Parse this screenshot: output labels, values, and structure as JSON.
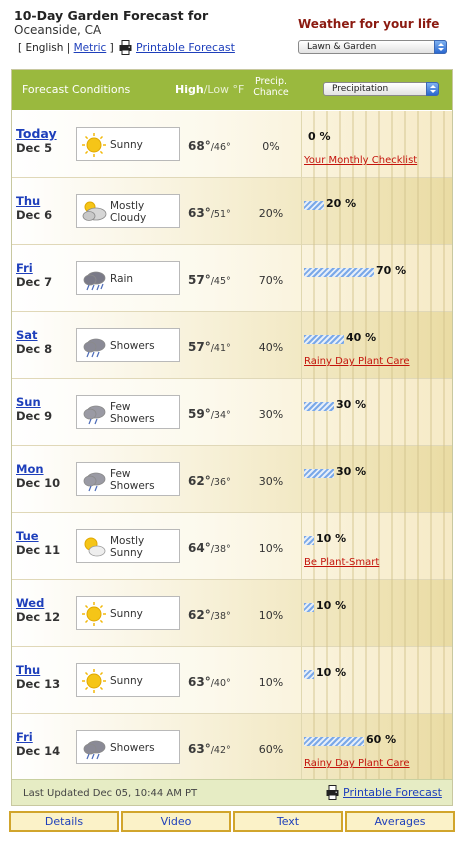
{
  "header": {
    "title": "10-Day Garden Forecast for",
    "location": "Oceanside, CA",
    "lang_open": "[",
    "english": "English",
    "sep": "|",
    "metric": "Metric",
    "lang_close": "]",
    "printable": "Printable Forecast",
    "wfyl": "Weather for your life",
    "lawn_select": "Lawn & Garden"
  },
  "table_header": {
    "conditions": "Forecast Conditions",
    "high": "High",
    "slash_low": "/Low °F",
    "precip_line1": "Precip.",
    "precip_line2": "Chance",
    "precip_select": "Precipitation"
  },
  "rows": [
    {
      "day": "Today",
      "date": "Dec 5",
      "cond": "Sunny",
      "icon": "sunny-icon",
      "hi": "68°",
      "lo": "/46°",
      "pct": "0%",
      "bar_label": "0 %",
      "precip": 0,
      "promo": "Your Monthly Checklist"
    },
    {
      "day": "Thu",
      "date": "Dec 6",
      "cond": "Mostly Cloudy",
      "icon": "mostly-cloudy-icon",
      "hi": "63°",
      "lo": "/51°",
      "pct": "20%",
      "bar_label": "20 %",
      "precip": 20,
      "promo": ""
    },
    {
      "day": "Fri",
      "date": "Dec 7",
      "cond": "Rain",
      "icon": "rain-icon",
      "hi": "57°",
      "lo": "/45°",
      "pct": "70%",
      "bar_label": "70 %",
      "precip": 70,
      "promo": ""
    },
    {
      "day": "Sat",
      "date": "Dec 8",
      "cond": "Showers",
      "icon": "showers-icon",
      "hi": "57°",
      "lo": "/41°",
      "pct": "40%",
      "bar_label": "40 %",
      "precip": 40,
      "promo": "Rainy Day Plant Care"
    },
    {
      "day": "Sun",
      "date": "Dec 9",
      "cond": "Few Showers",
      "icon": "few-showers-icon",
      "hi": "59°",
      "lo": "/34°",
      "pct": "30%",
      "bar_label": "30 %",
      "precip": 30,
      "promo": ""
    },
    {
      "day": "Mon",
      "date": "Dec 10",
      "cond": "Few Showers",
      "icon": "few-showers-icon",
      "hi": "62°",
      "lo": "/36°",
      "pct": "30%",
      "bar_label": "30 %",
      "precip": 30,
      "promo": ""
    },
    {
      "day": "Tue",
      "date": "Dec 11",
      "cond": "Mostly Sunny",
      "icon": "mostly-sunny-icon",
      "hi": "64°",
      "lo": "/38°",
      "pct": "10%",
      "bar_label": "10 %",
      "precip": 10,
      "promo": "Be Plant-Smart"
    },
    {
      "day": "Wed",
      "date": "Dec 12",
      "cond": "Sunny",
      "icon": "sunny-icon",
      "hi": "62°",
      "lo": "/38°",
      "pct": "10%",
      "bar_label": "10 %",
      "precip": 10,
      "promo": ""
    },
    {
      "day": "Thu",
      "date": "Dec 13",
      "cond": "Sunny",
      "icon": "sunny-icon",
      "hi": "63°",
      "lo": "/40°",
      "pct": "10%",
      "bar_label": "10 %",
      "precip": 10,
      "promo": ""
    },
    {
      "day": "Fri",
      "date": "Dec 14",
      "cond": "Showers",
      "icon": "showers-icon",
      "hi": "63°",
      "lo": "/42°",
      "pct": "60%",
      "bar_label": "60 %",
      "precip": 60,
      "promo": "Rainy Day Plant Care"
    }
  ],
  "footer": {
    "last_updated": "Last Updated Dec 05, 10:44 AM PT",
    "printable": "Printable Forecast"
  },
  "tabs": [
    "Details",
    "Video",
    "Text",
    "Averages"
  ],
  "colors": {
    "header_green": "#9ab93e",
    "link_blue": "#1e3fbb",
    "promo_red": "#c4140c",
    "title_red": "#8b1a10",
    "bar_blue": "#7aa8e8",
    "tab_border": "#d1a52c"
  }
}
